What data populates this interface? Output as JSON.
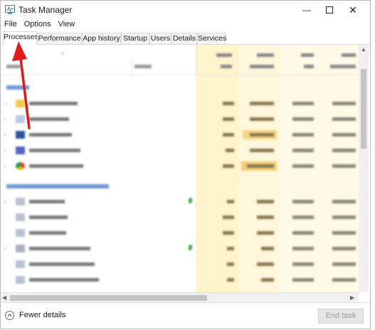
{
  "window": {
    "title": "Task Manager",
    "minimize_icon": "minimize-icon",
    "maximize_icon": "maximize-icon",
    "close_icon": "close-icon"
  },
  "menu": [
    "File",
    "Options",
    "View"
  ],
  "tabs": [
    "Processes",
    "Performance",
    "App history",
    "Startup",
    "Users",
    "Details",
    "Services"
  ],
  "active_tab": "Processes",
  "footer": {
    "fewer_details": "Fewer details",
    "end_task": "End task"
  },
  "colors": {
    "heat_light": "#fff7dc",
    "heat_mid": "#fff0bc",
    "heat_strong": "#f9de8e",
    "group_text": "#3572c7",
    "annotation_arrow": "#e01a1a"
  }
}
